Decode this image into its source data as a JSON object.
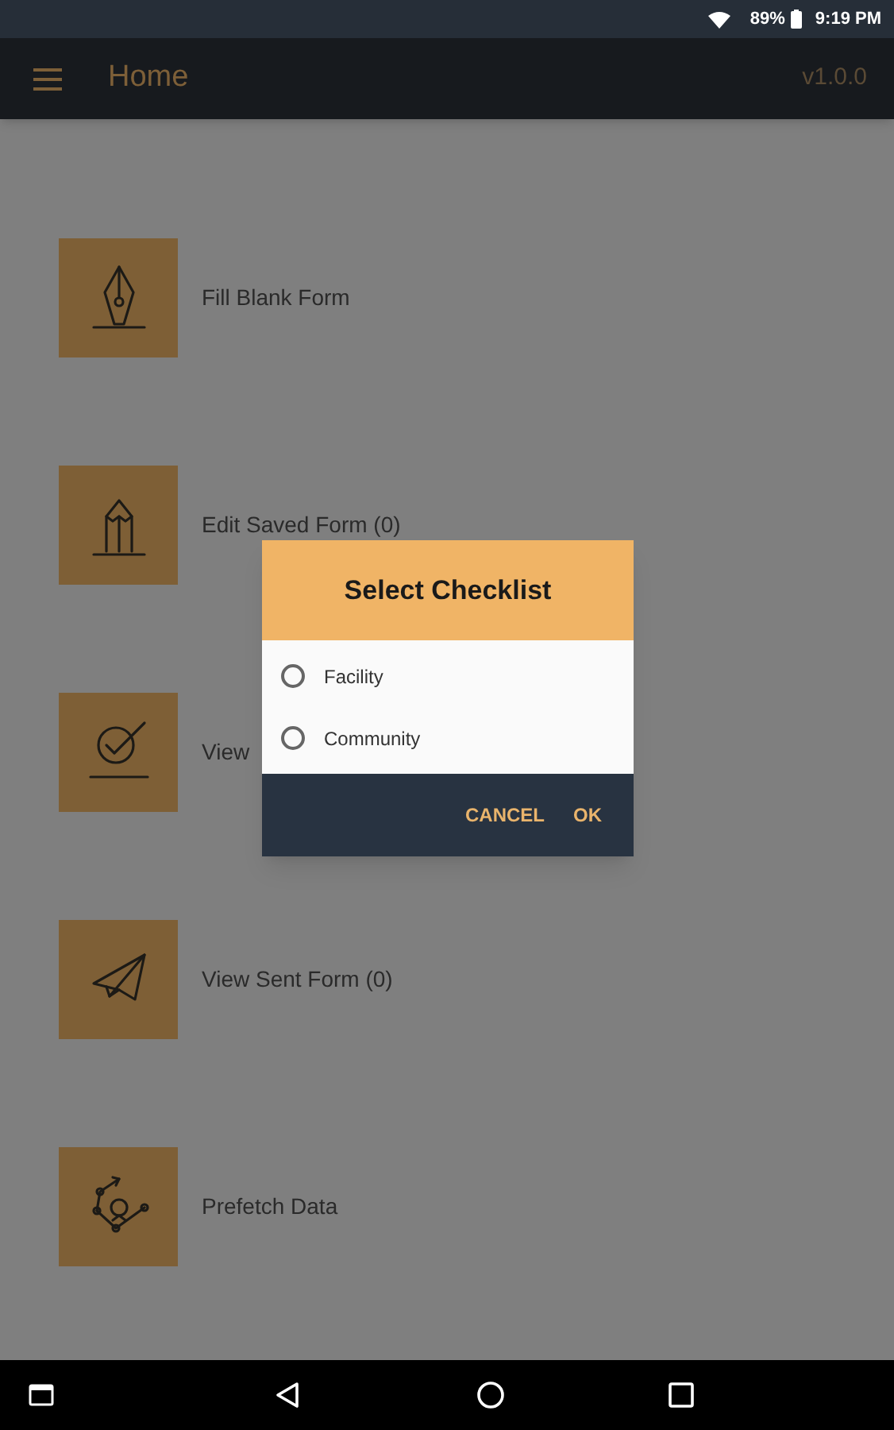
{
  "status_bar": {
    "battery": "89%",
    "time": "9:19 PM"
  },
  "app_bar": {
    "title": "Home",
    "version": "v1.0.0"
  },
  "menu": [
    {
      "kind": "pen",
      "label": "Fill Blank Form"
    },
    {
      "kind": "pencil",
      "label": "Edit Saved Form (0)"
    },
    {
      "kind": "check",
      "label": "View"
    },
    {
      "kind": "plane",
      "label": "View Sent Form (0)"
    },
    {
      "kind": "network",
      "label": "Prefetch Data"
    }
  ],
  "dialog": {
    "title": "Select Checklist",
    "options": [
      {
        "label": "Facility",
        "selected": false
      },
      {
        "label": "Community",
        "selected": false
      }
    ],
    "buttons": [
      "CANCEL",
      "OK"
    ]
  }
}
